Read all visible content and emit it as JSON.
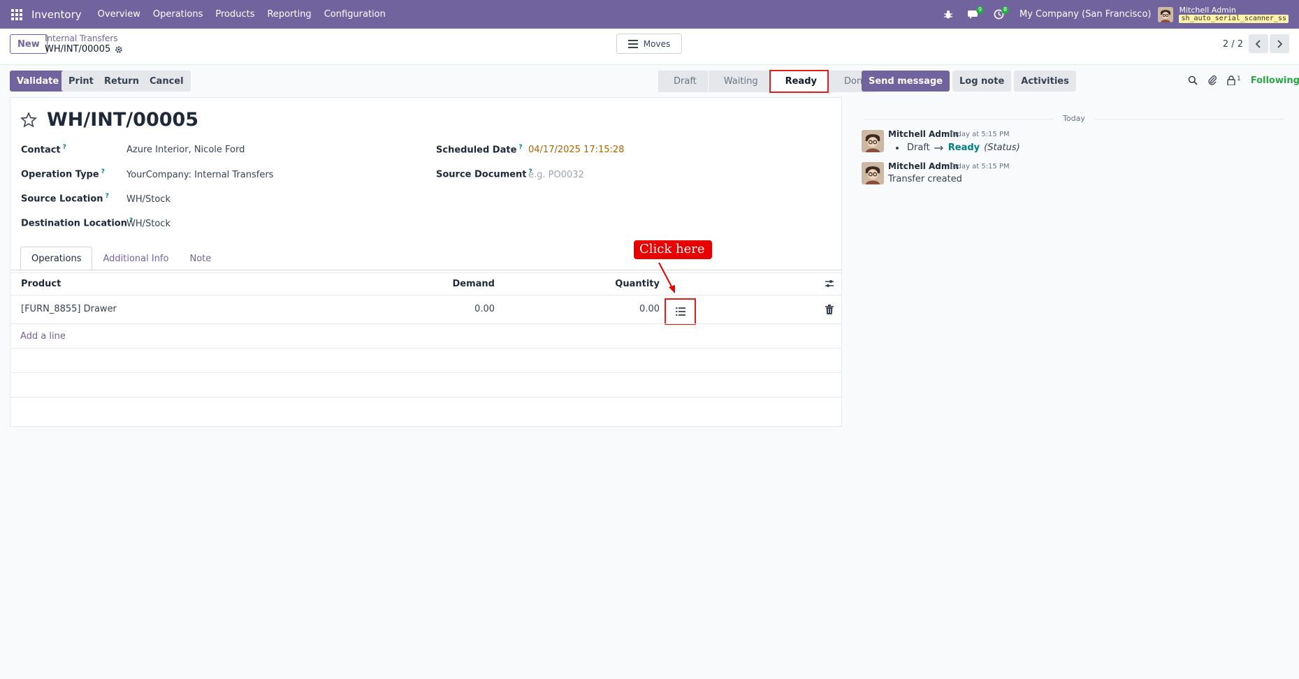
{
  "navbar": {
    "app_name": "Inventory",
    "menu": [
      "Overview",
      "Operations",
      "Products",
      "Reporting",
      "Configuration"
    ],
    "messages_badge": "9",
    "activities_badge": "8",
    "company": "My Company (San Francisco)",
    "user": "Mitchell Admin",
    "database": "sh_auto_serial_scanner_ss"
  },
  "control": {
    "new_label": "New",
    "breadcrumb": "Internal Transfers",
    "record": "WH/INT/00005",
    "moves_label": "Moves",
    "pager": "2 / 2"
  },
  "actions": {
    "validate": "Validate",
    "print": "Print",
    "return": "Return",
    "cancel": "Cancel"
  },
  "statusbar": {
    "stages": [
      "Draft",
      "Waiting",
      "Ready",
      "Done"
    ],
    "active": "Ready"
  },
  "form": {
    "title": "WH/INT/00005",
    "fields": {
      "contact_label": "Contact",
      "contact": "Azure Interior, Nicole Ford",
      "operation_type_label": "Operation Type",
      "operation_type": "YourCompany: Internal Transfers",
      "source_location_label": "Source Location",
      "source_location": "WH/Stock",
      "destination_location_label": "Destination Location",
      "destination_location": "WH/Stock",
      "scheduled_date_label": "Scheduled Date",
      "scheduled_date": "04/17/2025 17:15:28",
      "source_document_label": "Source Document",
      "source_document_placeholder": "e.g. PO0032"
    },
    "help_mark": "?",
    "tabs": [
      "Operations",
      "Additional Info",
      "Note"
    ],
    "table": {
      "columns": [
        "Product",
        "Demand",
        "Quantity"
      ],
      "rows": [
        {
          "product": "[FURN_8855] Drawer",
          "demand": "0.00",
          "quantity": "0.00"
        }
      ],
      "add_line": "Add a line"
    },
    "callout": "Click here",
    "status_date_color": "#a86500"
  },
  "chatter": {
    "send_message": "Send message",
    "log_note": "Log note",
    "activities": "Activities",
    "followers_count": "1",
    "following": "Following",
    "date_separator": "Today",
    "messages": [
      {
        "author": "Mitchell Admin",
        "time": "Today at 5:15 PM",
        "from": "Draft",
        "to": "Ready",
        "field": "(Status)"
      },
      {
        "author": "Mitchell Admin",
        "time": "Today at 5:15 PM",
        "body": "Transfer created"
      }
    ]
  }
}
